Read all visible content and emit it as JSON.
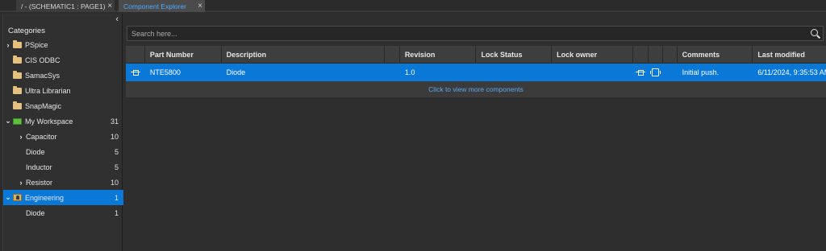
{
  "tabs": [
    {
      "label": "/ - (SCHEMATIC1 : PAGE1)",
      "close": "×"
    },
    {
      "label": "Component Explorer",
      "close": "×"
    }
  ],
  "panel": {
    "collapse_glyph": "‹",
    "header": "Categories",
    "tree": [
      {
        "label": "PSpice",
        "count": "",
        "icon": "folder-icon",
        "chevron": "›"
      },
      {
        "label": "CIS ODBC",
        "count": "",
        "icon": "folder-icon",
        "chevron": ""
      },
      {
        "label": "SamacSys",
        "count": "",
        "icon": "folder-icon",
        "chevron": ""
      },
      {
        "label": "Ultra Librarian",
        "count": "",
        "icon": "folder-icon",
        "chevron": ""
      },
      {
        "label": "SnapMagic",
        "count": "",
        "icon": "folder-icon",
        "chevron": ""
      },
      {
        "label": "My Workspace",
        "count": "31",
        "icon": "workspace-icon",
        "chevron": "⌄"
      },
      {
        "label": "Capacitor",
        "count": "10",
        "chevron": "›"
      },
      {
        "label": "Diode",
        "count": "5",
        "chevron": ""
      },
      {
        "label": "Inductor",
        "count": "5",
        "chevron": ""
      },
      {
        "label": "Resistor",
        "count": "10",
        "chevron": "›"
      },
      {
        "label": "Engineering",
        "count": "1",
        "icon": "engineering-icon",
        "chevron": "⌄"
      },
      {
        "label": "Diode",
        "count": "1",
        "chevron": ""
      }
    ]
  },
  "search": {
    "placeholder": "Search here...",
    "value": ""
  },
  "grid": {
    "columns": [
      "",
      "Part Number",
      "Description",
      "",
      "Revision",
      "Lock Status",
      "Lock owner",
      "",
      "",
      "",
      "Comments",
      "Last modified"
    ],
    "rows": [
      {
        "part_number": "NTE5800",
        "description": "Diode",
        "revision": "1.0",
        "lock_status": "",
        "lock_owner": "",
        "comments": "Initial push.",
        "last_modified": "6/11/2024, 9:35:53 AM"
      }
    ],
    "more_link": "Click to view more components"
  },
  "colors": {
    "selection": "#0a78d7",
    "active_tab_text": "#4fa8ff",
    "link": "#5aa7ee",
    "folder": "#e4c17e"
  }
}
